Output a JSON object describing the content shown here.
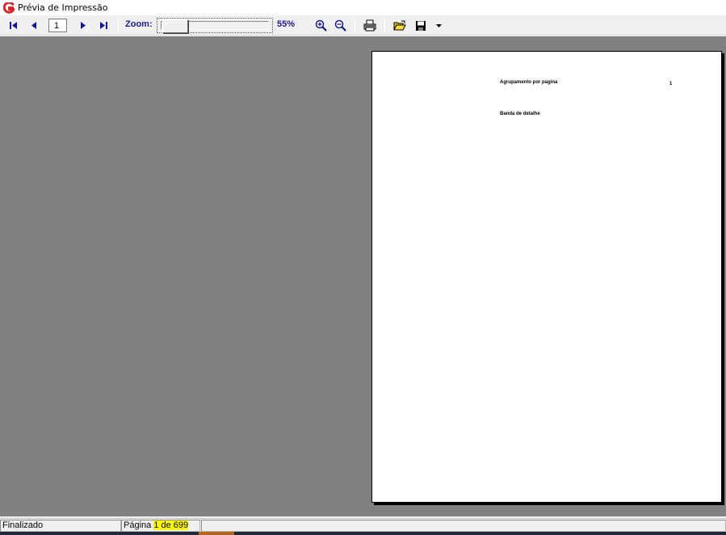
{
  "window": {
    "title": "Prévia de Impressão",
    "icon": "app-g-logo-icon"
  },
  "toolbar": {
    "first_page_icon": "first-page-icon",
    "prev_page_icon": "prev-page-icon",
    "page_number": "1",
    "next_page_icon": "next-page-icon",
    "last_page_icon": "last-page-icon",
    "zoom_label": "Zoom:",
    "zoom_value": "55%",
    "zoom_in_icon": "zoom-in-icon",
    "zoom_out_icon": "zoom-out-icon",
    "print_icon": "printer-icon",
    "open_icon": "open-folder-icon",
    "save_icon": "save-floppy-icon",
    "save_dropdown_icon": "chevron-down-icon",
    "accent_color": "#1a1a8c"
  },
  "preview": {
    "background_color": "#808080",
    "page": {
      "group_header": "Agrupamento por pagina",
      "page_number": "1",
      "detail_band": "Banda de detalhe"
    }
  },
  "status": {
    "state": "Finalizado",
    "page_label": "Página",
    "page_count": "1 de 699",
    "highlight_color": "#ffff00"
  }
}
